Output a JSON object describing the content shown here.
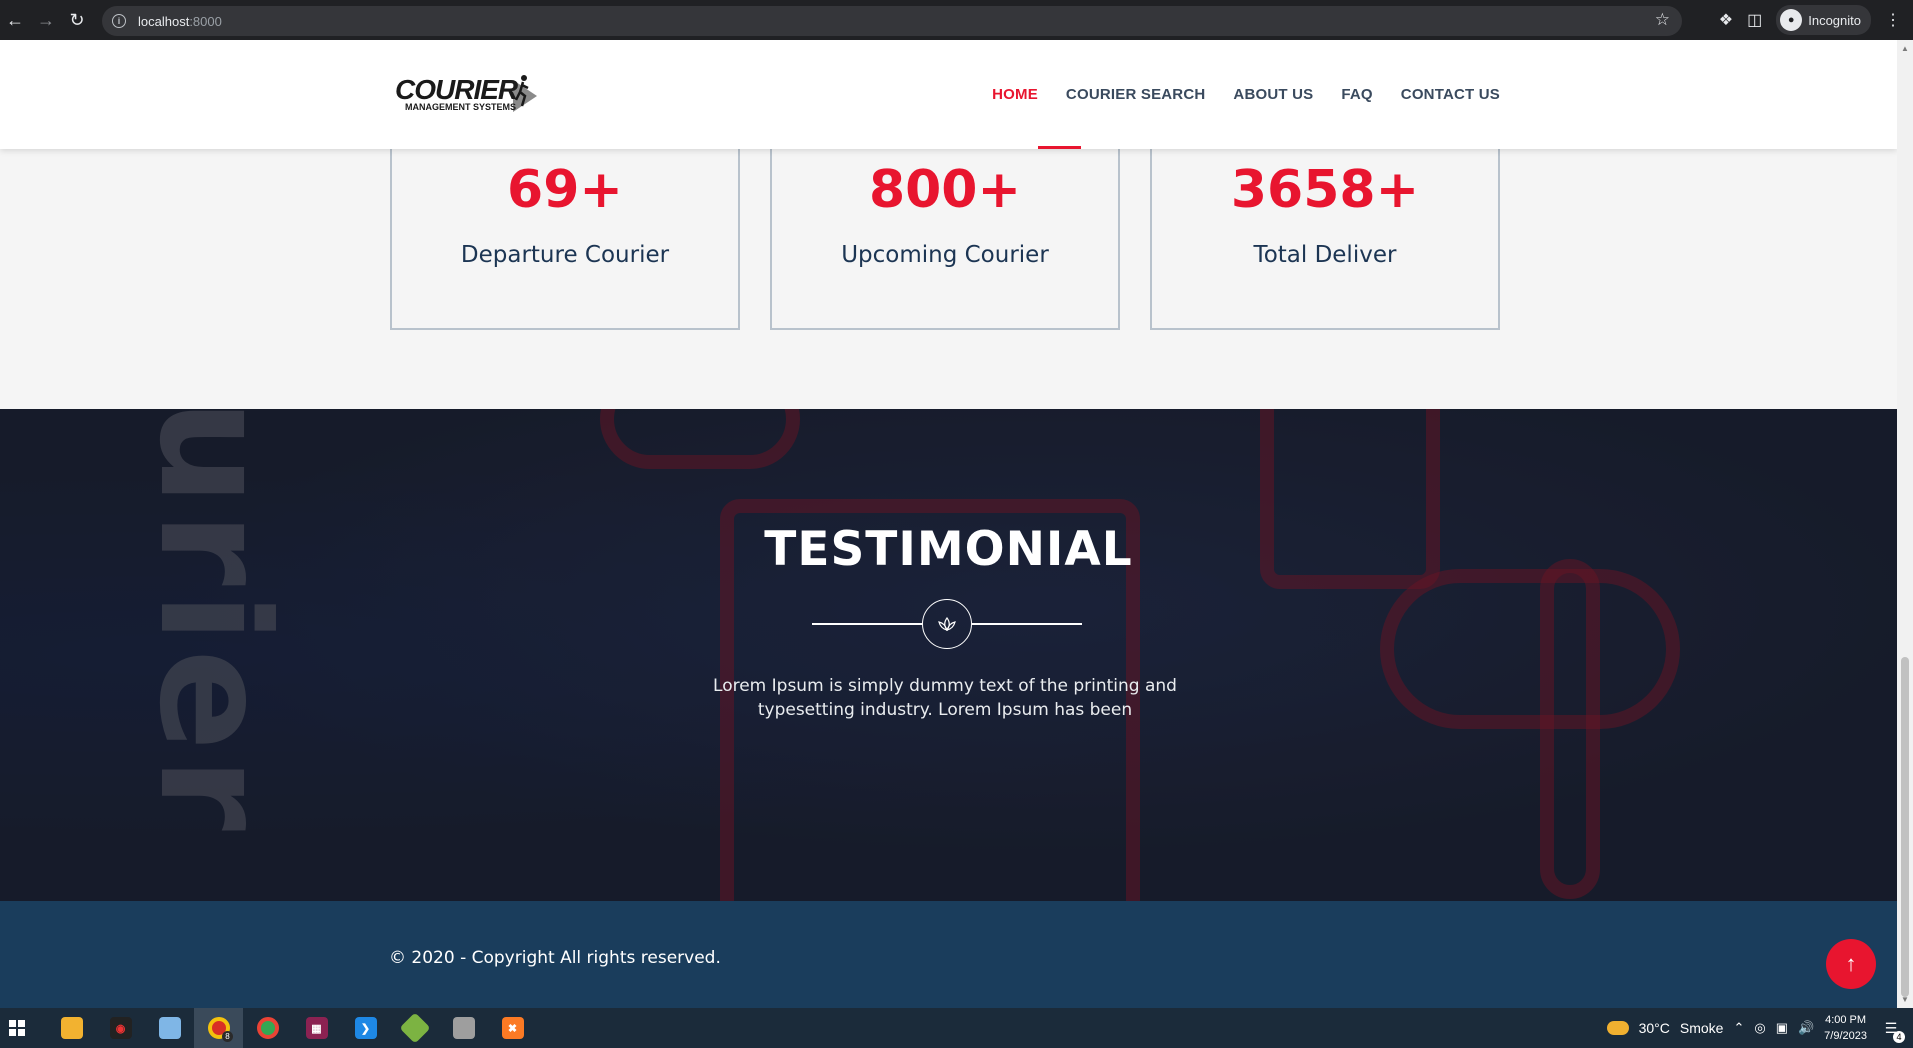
{
  "browser": {
    "url_host": "localhost",
    "url_port": ":8000",
    "profile_label": "Incognito"
  },
  "header": {
    "logo_word": "COURIER",
    "logo_sub": "MANAGEMENT SYSTEMS",
    "nav": [
      {
        "label": "HOME",
        "active": true
      },
      {
        "label": "COURIER SEARCH",
        "active": false
      },
      {
        "label": "ABOUT US",
        "active": false
      },
      {
        "label": "FAQ",
        "active": false
      },
      {
        "label": "CONTACT US",
        "active": false
      }
    ]
  },
  "stats": [
    {
      "number": "69+",
      "label": "Departure Courier"
    },
    {
      "number": "800+",
      "label": "Upcoming Courier"
    },
    {
      "number": "3658+",
      "label": "Total Deliver"
    }
  ],
  "testimonial": {
    "title": "TESTIMONIAL",
    "text": "Lorem Ipsum is simply dummy text of the printing and typesetting industry. Lorem Ipsum has been",
    "bg_word": "urier"
  },
  "footer": {
    "copyright": "© 2020 - Copyright All rights reserved."
  },
  "taskbar": {
    "weather_temp": "30°C",
    "weather_desc": "Smoke",
    "time": "4:00 PM",
    "date": "7/9/2023",
    "notification_count": "4",
    "chrome_badge": "8"
  },
  "colors": {
    "accent": "#e8152f",
    "navy": "#1c3553",
    "footer_bg": "#1a3d5c"
  }
}
